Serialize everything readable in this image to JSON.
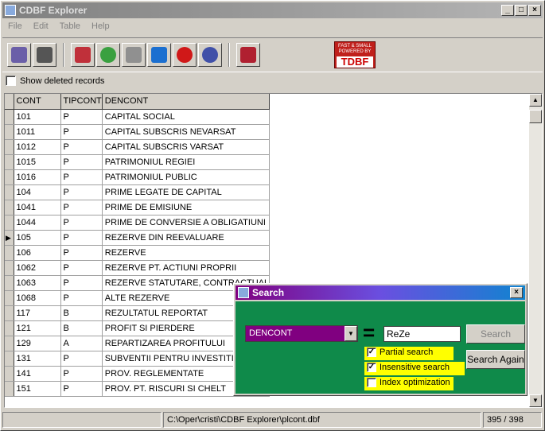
{
  "window": {
    "title": "CDBF Explorer"
  },
  "menu": [
    "File",
    "Edit",
    "Table",
    "Help"
  ],
  "toolbar": {
    "badge_top": "FAST & SMALL",
    "badge_mid": "POWERED BY",
    "badge_logo": "TDBF"
  },
  "show_deleted": {
    "label": "Show deleted records",
    "checked": false
  },
  "grid": {
    "columns": [
      "CONT",
      "TIPCONT",
      "DENCONT"
    ],
    "rows": [
      [
        "101",
        "P",
        "CAPITAL SOCIAL"
      ],
      [
        "1011",
        "P",
        "CAPITAL SUBSCRIS NEVARSAT"
      ],
      [
        "1012",
        "P",
        "CAPITAL SUBSCRIS VARSAT"
      ],
      [
        "1015",
        "P",
        "PATRIMONIUL REGIEI"
      ],
      [
        "1016",
        "P",
        "PATRIMONIUL PUBLIC"
      ],
      [
        "104",
        "P",
        "PRIME LEGATE DE CAPITAL"
      ],
      [
        "1041",
        "P",
        "PRIME DE EMISIUNE"
      ],
      [
        "1044",
        "P",
        "PRIME DE CONVERSIE A OBLIGATIUNI"
      ],
      [
        "105",
        "P",
        "REZERVE  DIN REEVALUARE"
      ],
      [
        "106",
        "P",
        "REZERVE"
      ],
      [
        "1062",
        "P",
        "REZERVE PT. ACTIUNI PROPRII"
      ],
      [
        "1063",
        "P",
        "REZERVE STATUTARE, CONTRACTUAL"
      ],
      [
        "1068",
        "P",
        "ALTE REZERVE"
      ],
      [
        "117",
        "B",
        "REZULTATUL REPORTAT"
      ],
      [
        "121",
        "B",
        "PROFIT SI PIERDERE"
      ],
      [
        "129",
        "A",
        "REPARTIZAREA PROFITULUI"
      ],
      [
        "131",
        "P",
        "SUBVENTII PENTRU INVESTITII"
      ],
      [
        "141",
        "P",
        "PROV. REGLEMENTATE"
      ],
      [
        "151",
        "P",
        "PROV. PT. RISCURI SI CHELT"
      ]
    ]
  },
  "status": {
    "left": "",
    "path": "C:\\Oper\\cristi\\CDBF Explorer\\plcont.dbf",
    "count": "395 / 398"
  },
  "search_dialog": {
    "title": "Search",
    "field": "DENCONT",
    "equals": "=",
    "value": "ReZe",
    "search_button": "Search",
    "search_again_button": "Search Again",
    "options": [
      {
        "label": "Partial search",
        "checked": true
      },
      {
        "label": "Insensitive search",
        "checked": true
      },
      {
        "label": "Index optimization",
        "checked": false
      }
    ]
  }
}
